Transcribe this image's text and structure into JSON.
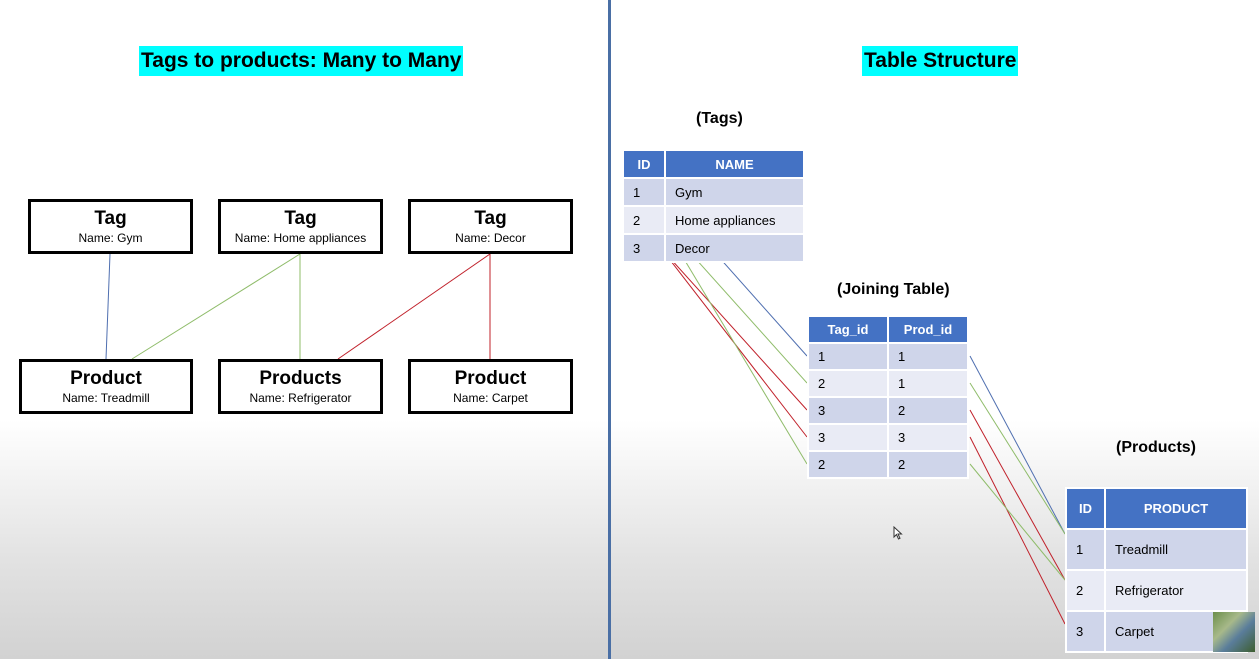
{
  "left": {
    "title": "Tags to products: Many to Many",
    "tags": [
      {
        "title": "Tag",
        "name": "Name: Gym"
      },
      {
        "title": "Tag",
        "name": "Name: Home appliances"
      },
      {
        "title": "Tag",
        "name": "Name: Decor"
      }
    ],
    "products": [
      {
        "title": "Product",
        "name": "Name: Treadmill"
      },
      {
        "title": "Products",
        "name": "Name: Refrigerator"
      },
      {
        "title": "Product",
        "name": "Name: Carpet"
      }
    ],
    "links": [
      {
        "tag": 0,
        "product": 0,
        "color": "#4f6fb0"
      },
      {
        "tag": 1,
        "product": 0,
        "color": "#8fbc6a"
      },
      {
        "tag": 1,
        "product": 1,
        "color": "#8fbc6a"
      },
      {
        "tag": 2,
        "product": 1,
        "color": "#c0202a"
      },
      {
        "tag": 2,
        "product": 2,
        "color": "#c0202a"
      }
    ]
  },
  "right": {
    "title": "Table Structure",
    "tags_table": {
      "caption": "(Tags)",
      "headers": [
        "ID",
        "NAME"
      ],
      "rows": [
        [
          "1",
          "Gym"
        ],
        [
          "2",
          "Home appliances"
        ],
        [
          "3",
          "Decor"
        ]
      ]
    },
    "join_table": {
      "caption": "(Joining Table)",
      "headers": [
        "Tag_id",
        "Prod_id"
      ],
      "rows": [
        [
          "1",
          "1"
        ],
        [
          "2",
          "1"
        ],
        [
          "3",
          "2"
        ],
        [
          "3",
          "3"
        ],
        [
          "2",
          "2"
        ]
      ]
    },
    "products_table": {
      "caption": "(Products)",
      "headers": [
        "ID",
        "PRODUCT"
      ],
      "rows": [
        [
          "1",
          "Treadmill"
        ],
        [
          "2",
          "Refrigerator"
        ],
        [
          "3",
          "Carpet"
        ]
      ]
    }
  },
  "colors": {
    "highlight": "#00ffff",
    "header": "#4472c4",
    "divider": "#4a6fa5",
    "row_odd": "#cfd5ea",
    "row_even": "#e9ebf5"
  }
}
